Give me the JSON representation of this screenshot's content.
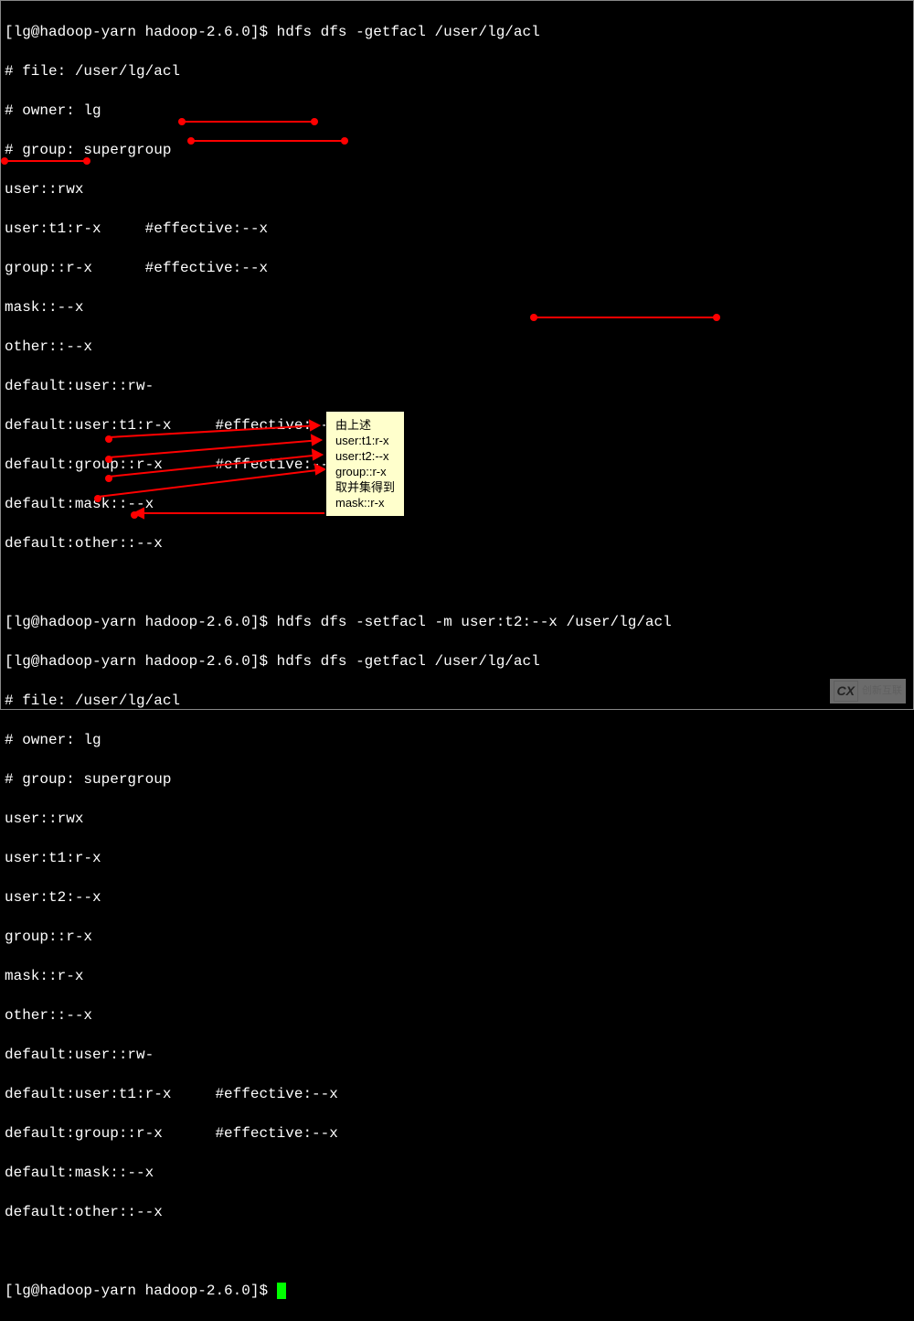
{
  "prompt1": {
    "userhost": "[lg@hadoop-yarn hadoop-2.6.0]$ ",
    "cmd": "hdfs dfs -getfacl /user/lg/acl"
  },
  "block1": {
    "l0": "# file: /user/lg/acl",
    "l1": "# owner: lg",
    "l2": "# group: supergroup",
    "l3": "user::rwx",
    "l4": "user:t1:r-x     #effective:--x",
    "l5": "group::r-x      #effective:--x",
    "l6": "mask::--x",
    "l7": "other::--x",
    "l8": "default:user::rw-",
    "l9": "default:user:t1:r-x     #effective:--x",
    "l10": "default:group::r-x      #effective:--x",
    "l11": "default:mask::--x",
    "l12": "default:other::--x"
  },
  "prompt2": {
    "userhost": "[lg@hadoop-yarn hadoop-2.6.0]$ ",
    "cmd": "hdfs dfs -setfacl -m user:t2:--x /user/lg/acl"
  },
  "prompt3": {
    "userhost": "[lg@hadoop-yarn hadoop-2.6.0]$ ",
    "cmd": "hdfs dfs -getfacl /user/lg/acl"
  },
  "block2": {
    "l0": "# file: /user/lg/acl",
    "l1": "# owner: lg",
    "l2": "# group: supergroup",
    "l3": "user::rwx",
    "l4": "user:t1:r-x",
    "l5": "user:t2:--x",
    "l6": "group::r-x",
    "l7": "mask::r-x",
    "l8": "other::--x",
    "l9": "default:user::rw-",
    "l10": "default:user:t1:r-x     #effective:--x",
    "l11": "default:group::r-x      #effective:--x",
    "l12": "default:mask::--x",
    "l13": "default:other::--x"
  },
  "prompt4": {
    "userhost": "[lg@hadoop-yarn hadoop-2.6.0]$ "
  },
  "annotation": {
    "l0": "由上述",
    "l1": "user:t1:r-x",
    "l2": "user:t2:--x",
    "l3": "group::r-x",
    "l4": "取并集得到",
    "l5": "mask::r-x"
  },
  "watermark": {
    "logo": "CX",
    "text": "创新互联"
  }
}
